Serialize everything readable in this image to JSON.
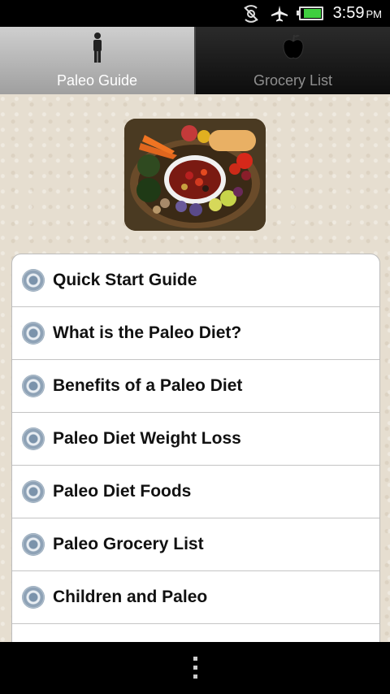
{
  "status_bar": {
    "time": "3:59",
    "ampm": "PM"
  },
  "tabs": [
    {
      "label": "Paleo Guide",
      "active": true
    },
    {
      "label": "Grocery List",
      "active": false
    }
  ],
  "menu": {
    "items": [
      {
        "label": "Quick Start Guide"
      },
      {
        "label": "What is the Paleo Diet?"
      },
      {
        "label": "Benefits of a Paleo Diet"
      },
      {
        "label": "Paleo Diet Weight Loss"
      },
      {
        "label": "Paleo Diet Foods"
      },
      {
        "label": "Paleo Grocery List"
      },
      {
        "label": "Children and Paleo"
      },
      {
        "label": ""
      }
    ]
  },
  "colors": {
    "accent": "#3fcf3f",
    "text": "#111111",
    "tab_active": "#bdbdbd",
    "tab_inactive": "#1b1b1b"
  },
  "icons": {
    "status": [
      "no-signal-icon",
      "airplane-icon",
      "battery-icon"
    ],
    "tabs": [
      "person-icon",
      "apple-icon"
    ],
    "bullet": "target-bullet-icon",
    "menu": "overflow-menu-icon"
  }
}
